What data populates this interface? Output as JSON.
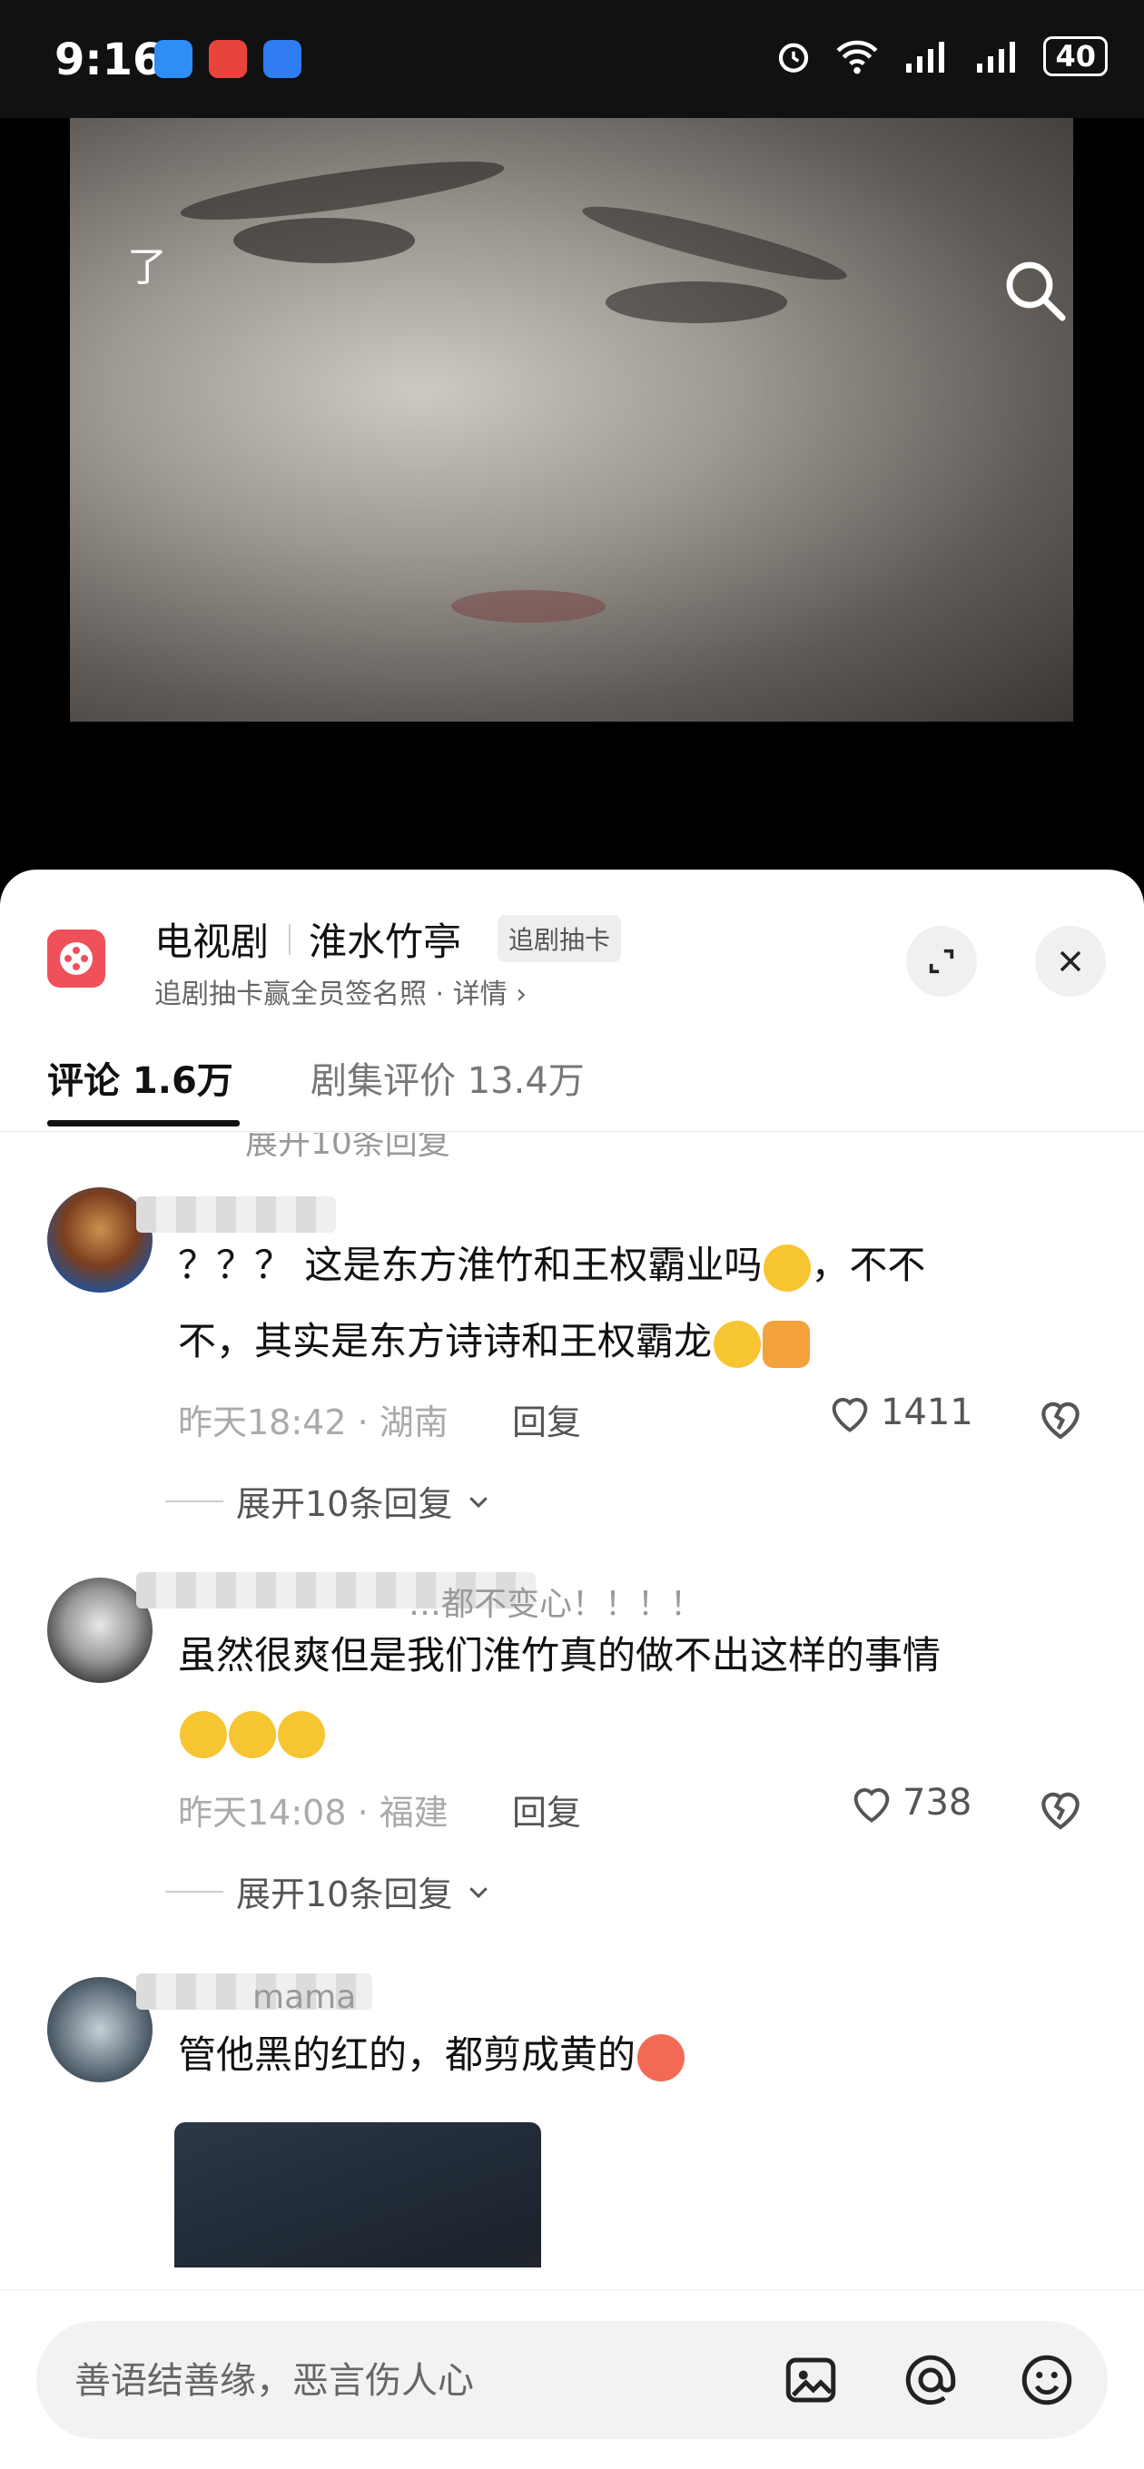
{
  "status_bar": {
    "time": "9:16",
    "battery": "40"
  },
  "video": {
    "watermark": "了"
  },
  "show": {
    "type": "电视剧",
    "name": "淮水竹亭",
    "tag": "追剧抽卡",
    "subtitle": "追剧抽卡赢全员签名照 · 详情 ›"
  },
  "tabs": [
    {
      "label": "评论 1.6万"
    },
    {
      "label": "剧集评价 13.4万"
    }
  ],
  "cut_text": "展开10条回复",
  "comments": [
    {
      "text_line1": "？？？ 这是东方淮竹和王权霸业吗",
      "text_line1_tail": "，不不",
      "text_line2": "不，其实是东方诗诗和王权霸龙",
      "time": "昨天18:42",
      "region": "湖南",
      "reply": "回复",
      "likes": "1411",
      "expand": "展开10条回复"
    },
    {
      "username_tail": "…都不变心！！！！",
      "text_line1": "虽然很爽但是我们淮竹真的做不出这样的事情",
      "time": "昨天14:08",
      "region": "福建",
      "reply": "回复",
      "likes": "738",
      "expand": "展开10条回复"
    },
    {
      "username_tail": "mama",
      "text_line1": "管他黑的红的，都剪成黄的"
    }
  ],
  "input": {
    "placeholder": "善语结善缘，恶言伤人心"
  },
  "colors": {
    "accent": "#f0505a",
    "panel": "#ffffff",
    "muted": "#aaaaaa"
  }
}
